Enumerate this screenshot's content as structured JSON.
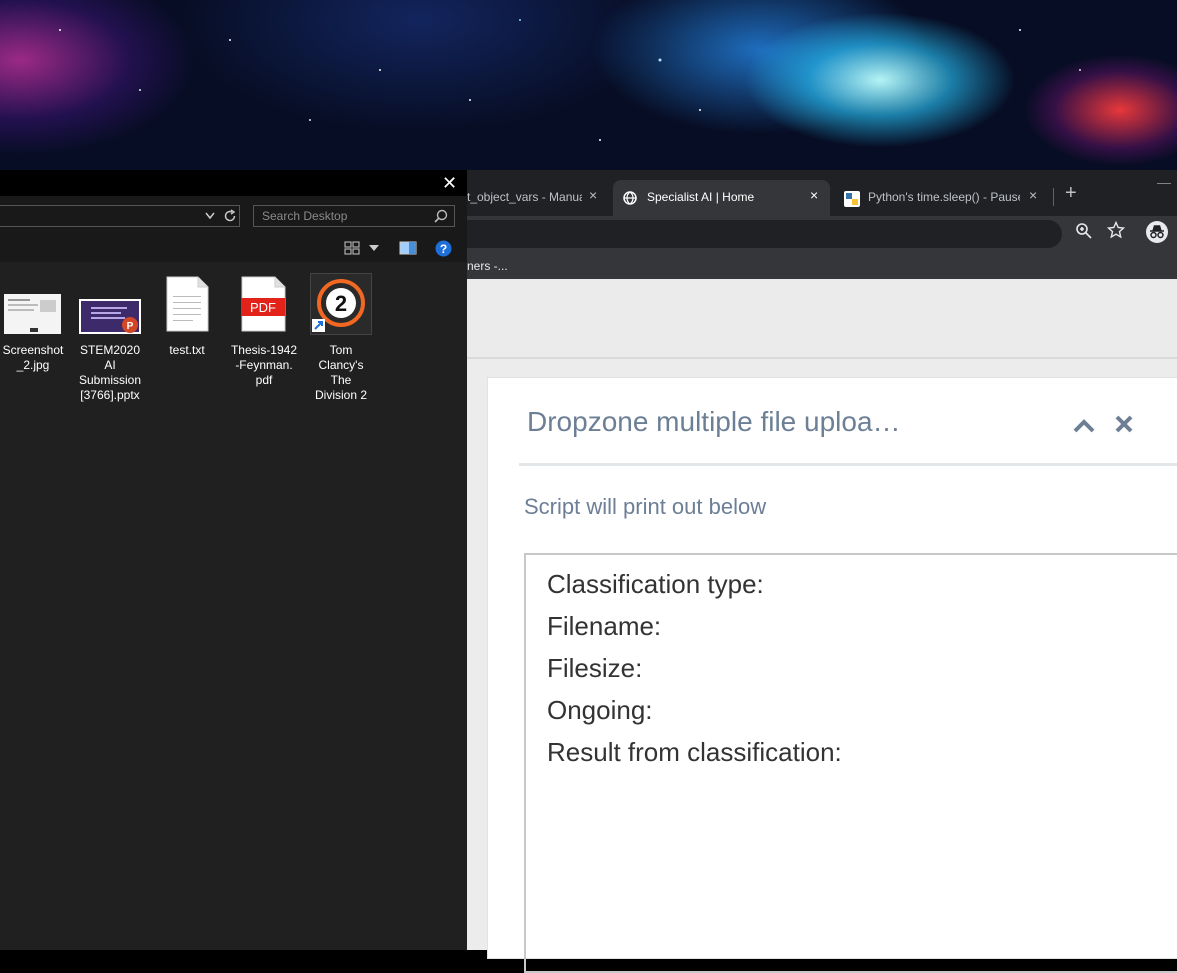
{
  "browser": {
    "tabs": [
      {
        "title": "t_object_vars - Manua",
        "active": false
      },
      {
        "title": "Specialist AI | Home",
        "active": true
      },
      {
        "title": "Python's time.sleep() - Pause,",
        "active": false
      }
    ],
    "new_tab": "+",
    "minimize": "—",
    "close_glyph": "×",
    "bookmarks_label": "ners -..."
  },
  "card": {
    "title": "Dropzone multiple file uploa…",
    "subtitle": "Script will print out below",
    "output_lines": [
      "Classification type:",
      "Filename:",
      "Filesize:",
      "Ongoing:",
      "Result from classification:"
    ]
  },
  "explorer": {
    "close_glyph": "✕",
    "search_placeholder": "Search Desktop",
    "files": [
      {
        "name": "Screenshot\n_2.jpg",
        "icon": "image-thumbnail-icon"
      },
      {
        "name": "STEM2020\nAI\nSubmission\n[3766].pptx",
        "icon": "powerpoint-file-icon"
      },
      {
        "name": "test.txt",
        "icon": "text-file-icon"
      },
      {
        "name": "Thesis-1942\n-Feynman.\npdf",
        "icon": "pdf-file-icon",
        "badge": "PDF"
      },
      {
        "name": "Tom\nClancy's\nThe\nDivision 2",
        "icon": "game-shortcut-icon",
        "badge": "2"
      }
    ]
  },
  "colors": {
    "card_title": "#6c7f95",
    "pdf_red": "#e2231a",
    "division_orange": "#f26822",
    "help_blue": "#1e6fd9"
  }
}
